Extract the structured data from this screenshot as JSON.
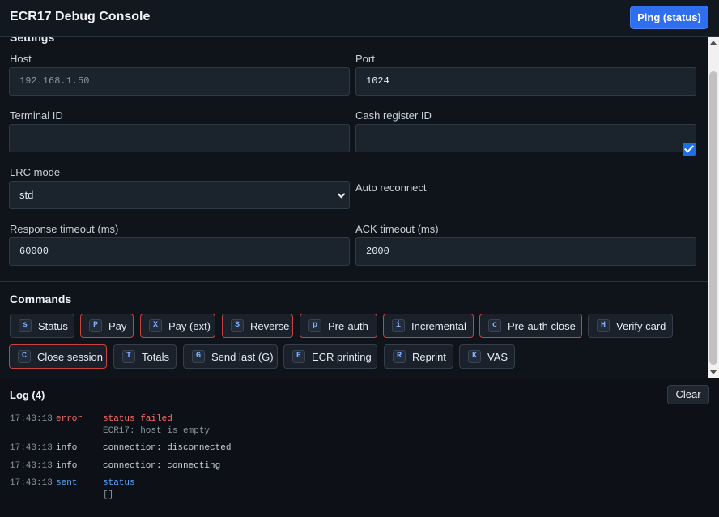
{
  "header": {
    "title": "ECR17 Debug Console",
    "ping_label": "Ping (status)"
  },
  "settings": {
    "section_title_cut": "Settings",
    "host": {
      "label": "Host",
      "value": "192.168.1.50"
    },
    "port": {
      "label": "Port",
      "value": "1024"
    },
    "terminal_id": {
      "label": "Terminal ID",
      "value": ""
    },
    "cash_register_id": {
      "label": "Cash register ID",
      "value": ""
    },
    "lrc_mode": {
      "label": "LRC mode",
      "value": "std"
    },
    "auto_reconnect": {
      "label": "Auto reconnect",
      "checked": true
    },
    "response_timeout": {
      "label": "Response timeout (ms)",
      "value": "60000"
    },
    "ack_timeout": {
      "label": "ACK timeout (ms)",
      "value": "2000"
    }
  },
  "commands": {
    "title": "Commands",
    "items": [
      {
        "key": "s",
        "label": "Status",
        "danger": false
      },
      {
        "key": "P",
        "label": "Pay",
        "danger": true
      },
      {
        "key": "X",
        "label": "Pay (ext)",
        "danger": true
      },
      {
        "key": "S",
        "label": "Reverse",
        "danger": true
      },
      {
        "key": "p",
        "label": "Pre-auth",
        "danger": true
      },
      {
        "key": "i",
        "label": "Incremental",
        "danger": true
      },
      {
        "key": "c",
        "label": "Pre-auth close",
        "danger": true
      },
      {
        "key": "H",
        "label": "Verify card",
        "danger": false
      },
      {
        "key": "C",
        "label": "Close session",
        "danger": true
      },
      {
        "key": "T",
        "label": "Totals",
        "danger": false
      },
      {
        "key": "G",
        "label": "Send last (G)",
        "danger": false
      },
      {
        "key": "E",
        "label": "ECR printing",
        "danger": false
      },
      {
        "key": "R",
        "label": "Reprint",
        "danger": false
      },
      {
        "key": "K",
        "label": "VAS",
        "danger": false
      }
    ]
  },
  "log": {
    "title": "Log (4)",
    "clear_label": "Clear",
    "entries": [
      {
        "time": "17:43:13",
        "level": "error",
        "message": "status failed",
        "detail": "ECR17: host is empty"
      },
      {
        "time": "17:43:13",
        "level": "info",
        "message": "connection: disconnected",
        "detail": ""
      },
      {
        "time": "17:43:13",
        "level": "info",
        "message": "connection: connecting",
        "detail": ""
      },
      {
        "time": "17:43:13",
        "level": "sent",
        "message": "status",
        "detail": "[]"
      }
    ]
  },
  "colors": {
    "accent": "#2f6fed",
    "error": "#ff6b6b",
    "info": "#c9d1d9",
    "sent": "#58a6ff",
    "danger_border": "#c9423f",
    "background": "#0f141b"
  }
}
